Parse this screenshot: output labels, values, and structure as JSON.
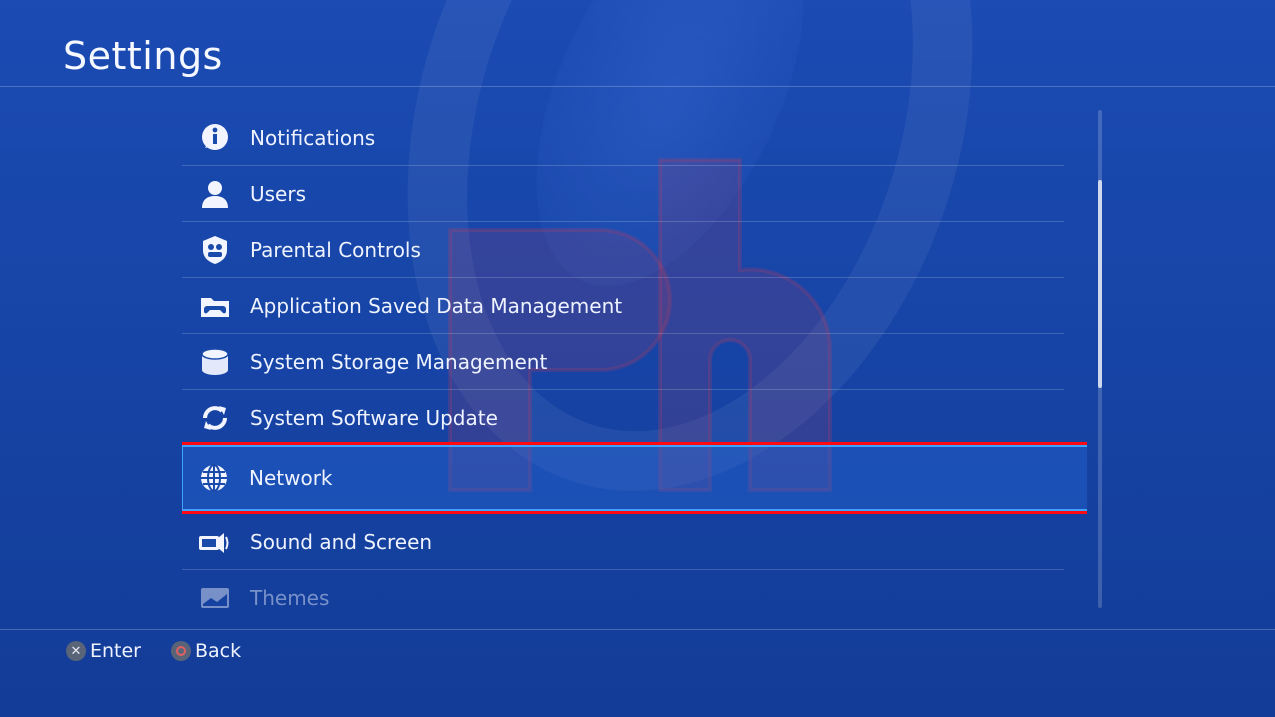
{
  "header": {
    "title": "Settings"
  },
  "menu": {
    "items": [
      {
        "label": "Notifications",
        "icon": "info-icon"
      },
      {
        "label": "Users",
        "icon": "user-icon"
      },
      {
        "label": "Parental Controls",
        "icon": "parental-controls-icon"
      },
      {
        "label": "Application Saved Data Management",
        "icon": "saved-data-icon"
      },
      {
        "label": "System Storage Management",
        "icon": "storage-icon"
      },
      {
        "label": "System Software Update",
        "icon": "update-icon"
      },
      {
        "label": "Network",
        "icon": "globe-icon",
        "selected": true
      },
      {
        "label": "Sound and Screen",
        "icon": "sound-screen-icon"
      },
      {
        "label": "Themes",
        "icon": "themes-icon"
      }
    ]
  },
  "footer": {
    "enter_label": "Enter",
    "back_label": "Back"
  },
  "colors": {
    "background": "#1745a8",
    "highlight_border": "#ff0a12",
    "selection_glow": "#3fa2ff"
  }
}
